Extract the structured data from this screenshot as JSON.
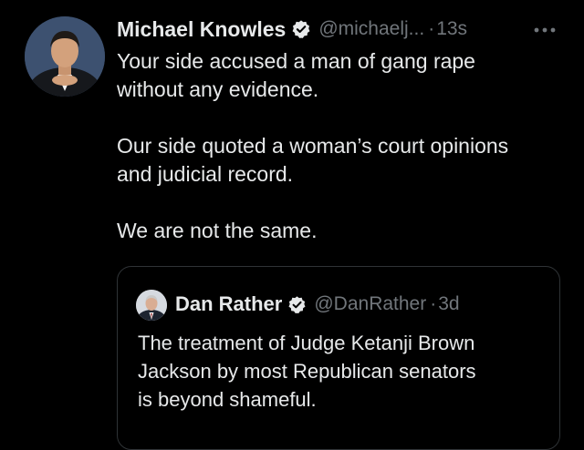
{
  "tweet": {
    "author_name": "Michael Knowles",
    "handle": "@michaelj...",
    "time": "13s",
    "separator": "·",
    "paragraphs": [
      "Your side accused a man of gang rape\nwithout any evidence.",
      "Our side quoted a woman’s court opinions\nand judicial record.",
      "We are not the same."
    ],
    "icons": {
      "verified": "verified-badge-icon",
      "more": "more-options-icon"
    }
  },
  "quote": {
    "author_name": "Dan Rather",
    "handle": "@DanRather",
    "time": "3d",
    "separator": "·",
    "text": "The treatment of Judge Ketanji Brown\nJackson by most Republican senators\nis beyond shameful."
  },
  "colors": {
    "background": "#000000",
    "text": "#e7e9ea",
    "secondary": "#71767b",
    "border": "#2f3336",
    "badge_fill": "#e7e9ea"
  }
}
